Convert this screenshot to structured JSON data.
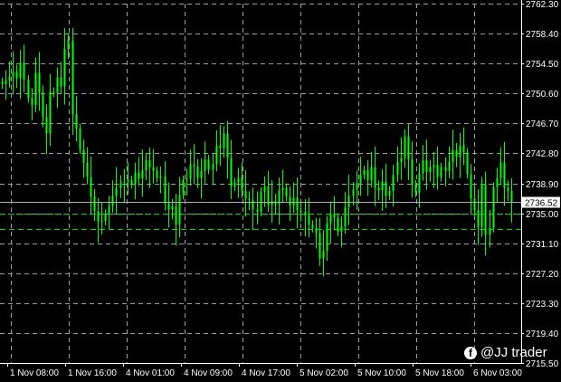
{
  "chart_data": {
    "type": "candlestick",
    "colors": {
      "background": "#000000",
      "grid": "#9aa0a0",
      "up": "#00ff00",
      "down": "#00ff00",
      "bid_line": "#b0b0b0",
      "level_line": "#00dd00",
      "axis_text": "#ffffff"
    },
    "ylim": [
      2715.5,
      2762.3
    ],
    "y_ticks": [
      "2762.30",
      "2758.40",
      "2754.50",
      "2750.60",
      "2746.70",
      "2742.80",
      "2738.90",
      "2735.00",
      "2731.10",
      "2727.20",
      "2723.30",
      "2719.40",
      "2715.50"
    ],
    "x_ticks": [
      "1 Nov 08:00",
      "1 Nov 16:00",
      "4 Nov 01:00",
      "4 Nov 09:00",
      "4 Nov 17:00",
      "5 Nov 02:00",
      "5 Nov 10:00",
      "5 Nov 18:00",
      "6 Nov 03:00"
    ],
    "current_price": "2736.52",
    "horizontal_levels": [
      2735.0,
      2733.0
    ],
    "grid": true,
    "closes": [
      2751.8,
      2752.3,
      2752.8,
      2753.4,
      2752.6,
      2754.6,
      2752.4,
      2750.0,
      2749.1,
      2753.3,
      2750.7,
      2747.5,
      2745.4,
      2750.8,
      2750.7,
      2752.7,
      2751.5,
      2756.4,
      2757.5,
      2747.9,
      2746.0,
      2743.3,
      2741.6,
      2739.7,
      2737.2,
      2735.3,
      2733.9,
      2734.0,
      2734.9,
      2736.0,
      2737.3,
      2738.3,
      2739.0,
      2739.1,
      2739.3,
      2738.8,
      2740.3,
      2739.5,
      2740.6,
      2741.9,
      2741.0,
      2740.5,
      2739.6,
      2739.8,
      2736.3,
      2735.5,
      2735.9,
      2733.5,
      2737.4,
      2739.3,
      2739.5,
      2741.3,
      2741.1,
      2739.6,
      2740.5,
      2742.0,
      2740.7,
      2741.4,
      2743.8,
      2743.5,
      2745.4,
      2742.2,
      2738.5,
      2739.0,
      2739.6,
      2737.9,
      2736.9,
      2736.7,
      2735.5,
      2735.2,
      2737.8,
      2738.5,
      2736.1,
      2736.6,
      2736.2,
      2738.0,
      2738.3,
      2737.2,
      2736.0,
      2737.0,
      2735.4,
      2735.2,
      2734.7,
      2733.5,
      2733.1,
      2732.4,
      2729.1,
      2730.1,
      2733.7,
      2734.9,
      2734.4,
      2732.6,
      2733.3,
      2735.8,
      2737.3,
      2738.1,
      2738.9,
      2740.0,
      2740.6,
      2739.3,
      2741.0,
      2738.3,
      2738.0,
      2739.1,
      2737.3,
      2737.9,
      2740.0,
      2741.7,
      2742.2,
      2745.0,
      2742.0,
      2738.7,
      2737.7,
      2740.2,
      2741.9,
      2740.4,
      2741.0,
      2741.3,
      2739.7,
      2741.0,
      2740.5,
      2741.7,
      2743.2,
      2742.3,
      2743.8,
      2742.9,
      2740.1,
      2736.9,
      2735.4,
      2733.2,
      2738.8,
      2732.2,
      2733.1,
      2738.4,
      2739.6,
      2741.6,
      2738.3,
      2737.9,
      2736.5
    ]
  },
  "watermark": {
    "icon": "facebook-icon",
    "text": "@JJ trader"
  }
}
